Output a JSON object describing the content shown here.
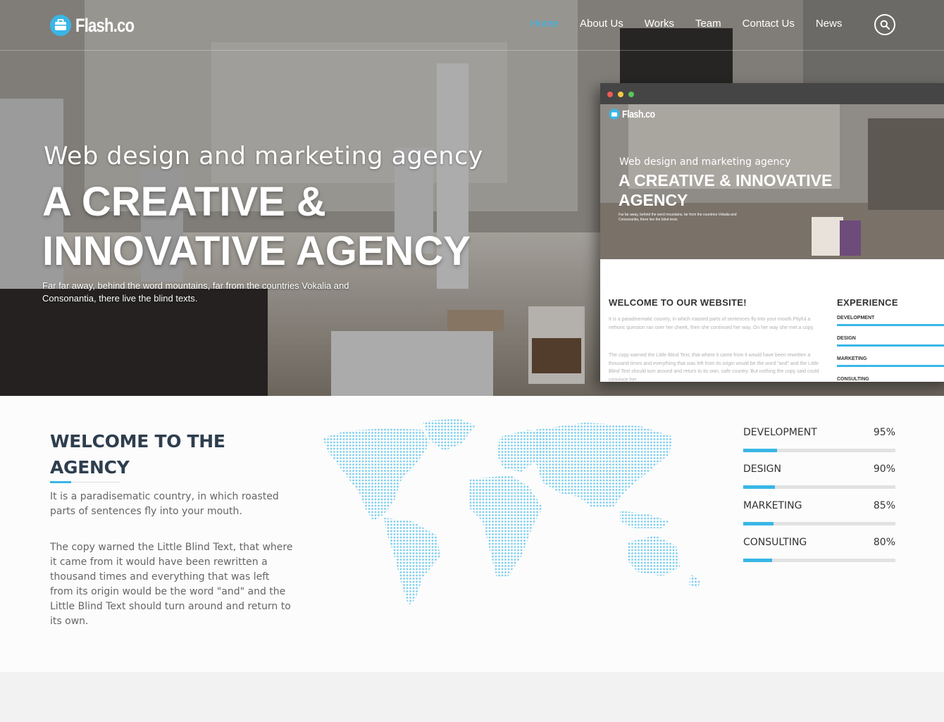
{
  "brand": {
    "name": "Flash.co"
  },
  "nav": {
    "items": [
      {
        "label": "Home",
        "active": true
      },
      {
        "label": "About Us",
        "active": false
      },
      {
        "label": "Works",
        "active": false
      },
      {
        "label": "Team",
        "active": false
      },
      {
        "label": "Contact Us",
        "active": false
      },
      {
        "label": "News",
        "active": false
      }
    ],
    "search_icon": "search-icon"
  },
  "hero": {
    "subtitle": "Web design and marketing agency",
    "title": "A CREATIVE & INNOVATIVE AGENCY",
    "text": "Far far away, behind the word mountains, far from the countries Vokalia and Consonantia, there live the blind texts."
  },
  "mockup": {
    "brand": "Flash.co",
    "subtitle": "Web design and marketing agency",
    "title": "A CREATIVE & INNOVATIVE AGENCY",
    "small_text": "Far far away, behind the word mountains, far from the countries Vokalia and Consonantia, there live the blind texts.",
    "welcome_title": "WELCOME TO OUR WEBSITE!",
    "para1": "It is a paradisematic country, in which roasted parts of sentences fly into your mouth.Pityful a rethoric question ran over her cheek, then she continued her way. On her way she met a copy.",
    "para2": "The copy warned the Little Blind Text, that where it came from it would have been rewritten a thousand times and everything that was left from its origin would be the word \"and\" and the Little Blind Text should turn around and return to its own, safe country. But nothing the copy said could convince her",
    "experience_title": "EXPERIENCE",
    "skills": [
      "DEVELOPMENT",
      "DESIGN",
      "MARKETING",
      "CONSULTING"
    ]
  },
  "welcome": {
    "title": "WELCOME TO THE AGENCY",
    "para1": "It is a paradisematic country, in which roasted parts of sentences fly into your mouth.",
    "para2": "The copy warned the Little Blind Text, that where it came from it would have been rewritten a thousand times and everything that was left from its origin would be the word \"and\" and the Little Blind Text should turn around and return to its own."
  },
  "skills": [
    {
      "name": "DEVELOPMENT",
      "percent_label": "95%",
      "level": 0.22
    },
    {
      "name": "DESIGN",
      "percent_label": "90%",
      "level": 0.21
    },
    {
      "name": "MARKETING",
      "percent_label": "85%",
      "level": 0.2
    },
    {
      "name": "CONSULTING",
      "percent_label": "80%",
      "level": 0.19
    }
  ],
  "map": {
    "icon": "world-map-dots"
  },
  "colors": {
    "accent": "#39b6e6",
    "heading": "#2e3e4e",
    "body_text": "#666666",
    "track": "#e2e2e2"
  }
}
